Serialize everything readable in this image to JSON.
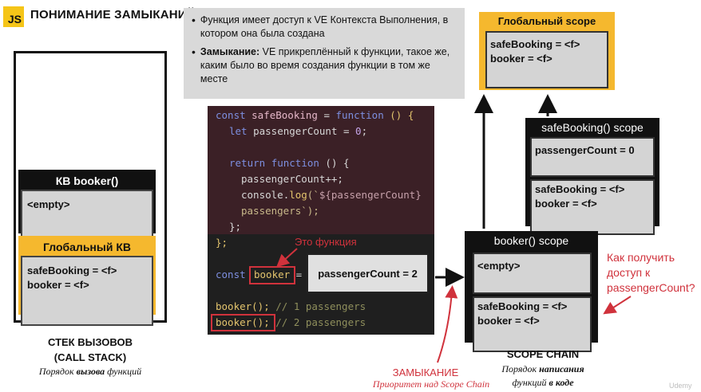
{
  "header": {
    "logo": "JS",
    "title": "ПОНИМАНИЕ ЗАМЫКАНИЙ"
  },
  "bullets": [
    "Функция имеет доступ к VE Контекста Выполнения, в котором она была создана",
    {
      "bold": "Замыкание:",
      "text": " VE прикреплённый к функции, такое же, каким было во время создания функции в том же месте"
    }
  ],
  "call_stack": {
    "booker_ctx": {
      "title": "КВ booker()",
      "content": "<empty>"
    },
    "global_ctx": {
      "title": "Глобальный КВ",
      "lines": [
        "safeBooking = <f>",
        "booker = <f>"
      ]
    },
    "caption_line1": "СТЕК ВЫЗОВОВ",
    "caption_line2": "(CALL STACK)",
    "subcaption_prefix": "Порядок ",
    "subcaption_bold": "вызова",
    "subcaption_suffix": " функций"
  },
  "code": {
    "l1_const": "const ",
    "l1_name": "safeBooking",
    "l1_eq": " = ",
    "l1_fn": "function",
    "l1_rest": " () {",
    "l2_let": "let ",
    "l2_var": "passengerCount",
    "l2_eq": " = ",
    "l2_num": "0",
    "l2_end": ";",
    "l4_return": "return ",
    "l4_fn": "function",
    "l4_rest": " () {",
    "l5": "passengerCount++;",
    "l6_obj": "console",
    "l6_dot": ".",
    "l6_fn": "log",
    "l6_open": "(`",
    "l6_tpl": "${passengerCount}",
    "l7": "passengers`);",
    "l8": "};",
    "l9": "};",
    "l10_const": "const ",
    "l10_name": "booker",
    "l10_eq": " =",
    "l11_call": "booker();",
    "l11_comment": " // 1 passengers",
    "l12_call": "booker();",
    "l12_comment": " // 2 passengers"
  },
  "annotations": {
    "this_function": "Это функция",
    "passenger_count": "passengerCount = 2",
    "closure_title": "ЗАМЫКАНИЕ",
    "closure_sub": "Приоритет над Scope Chain",
    "question": "Как получить доступ к passengerCount?"
  },
  "scopes": {
    "global": {
      "title": "Глобальный scope",
      "lines": [
        "safeBooking = <f>",
        "booker = <f>"
      ]
    },
    "safe_booking": {
      "title": "safeBooking() scope",
      "var": "passengerCount = 0",
      "lines": [
        "safeBooking = <f>",
        "booker = <f>"
      ]
    },
    "booker": {
      "title": "booker() scope",
      "content": "<empty>",
      "lines": [
        "safeBooking = <f>",
        "booker = <f>"
      ]
    },
    "caption": "SCOPE CHAIN",
    "sub_prefix": "Порядок ",
    "sub_bold": "написания",
    "sub_line2_prefix": "функций ",
    "sub_line2_bold": "в коде"
  },
  "watermark": "Udemy",
  "colors": {
    "accent_yellow": "#f5b82e",
    "red": "#d0323c",
    "code_bg_top": "#3b2026",
    "code_bg_bottom": "#1f1f1f"
  }
}
